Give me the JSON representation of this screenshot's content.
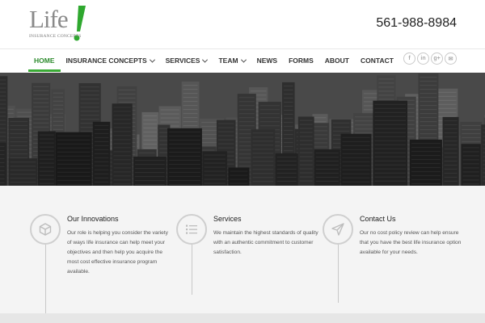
{
  "logo": {
    "word": "Life",
    "tagline": "INSURANCE CONCEPTS"
  },
  "phone": "561-988-8984",
  "nav": {
    "items": [
      {
        "label": "HOME",
        "active": true,
        "dropdown": false
      },
      {
        "label": "INSURANCE CONCEPTS",
        "active": false,
        "dropdown": true
      },
      {
        "label": "SERVICES",
        "active": false,
        "dropdown": true
      },
      {
        "label": "TEAM",
        "active": false,
        "dropdown": true
      },
      {
        "label": "NEWS",
        "active": false,
        "dropdown": false
      },
      {
        "label": "FORMS",
        "active": false,
        "dropdown": false
      },
      {
        "label": "ABOUT",
        "active": false,
        "dropdown": false
      },
      {
        "label": "CONTACT",
        "active": false,
        "dropdown": false
      }
    ],
    "socials": [
      {
        "icon": "facebook-icon",
        "glyph": "f"
      },
      {
        "icon": "linkedin-icon",
        "glyph": "in"
      },
      {
        "icon": "google-plus-icon",
        "glyph": "g+"
      },
      {
        "icon": "email-icon",
        "glyph": "✉"
      }
    ]
  },
  "hero": {
    "image": "city-skyline-grayscale"
  },
  "features": [
    {
      "icon": "cube-icon",
      "title": "Our Innovations",
      "text": "Our role is helping you consider the variety of ways life insurance can help meet your objectives and then help you acquire the most cost effective insurance program available."
    },
    {
      "icon": "list-icon",
      "title": "Services",
      "text": "We maintain the highest standards of quality with an authentic commitment to customer satisfaction."
    },
    {
      "icon": "send-icon",
      "title": "Contact Us",
      "text": "Our no cost policy review can help ensure that you have the best life insurance option available for your needs."
    }
  ],
  "colors": {
    "accent": "#3aaa35",
    "text": "#333333",
    "feature_bg": "#f4f4f4"
  }
}
